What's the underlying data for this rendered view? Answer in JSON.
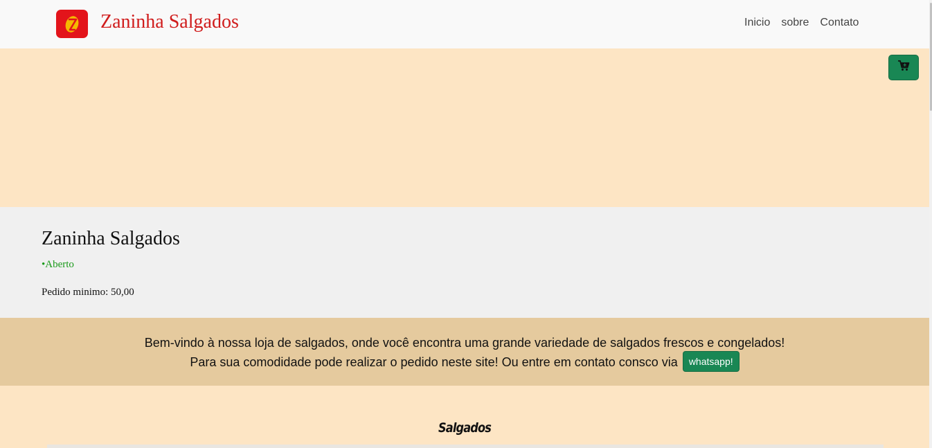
{
  "brand": {
    "name": "Zaninha Salgados",
    "logo_icon": "z-logo-icon",
    "logo_color": "#e3141b",
    "logo_letter_color": "#f5b800"
  },
  "nav": {
    "items": [
      {
        "label": "Inicio"
      },
      {
        "label": "sobre"
      },
      {
        "label": "Contato"
      }
    ]
  },
  "cart": {
    "icon": "cart-plus-icon",
    "color": "#198754"
  },
  "store": {
    "name": "Zaninha Salgados",
    "status": "•Aberto",
    "min_order": "Pedido minimo: 50,00"
  },
  "welcome": {
    "line1": "Bem-vindo à nossa loja de salgados, onde você encontra uma grande variedade de salgados frescos e congelados!",
    "line2": "Para sua comodidade pode realizar o pedido neste site! Ou entre em contato consco via",
    "whatsapp_label": "whatsapp!"
  },
  "sections": {
    "salgados_title": "Salgados"
  },
  "colors": {
    "hero_bg": "#fde5c4",
    "info_bg": "#f0f0f0",
    "welcome_bg": "#e5ca9e",
    "accent_green": "#198754",
    "brand_red": "#d01c1c"
  }
}
